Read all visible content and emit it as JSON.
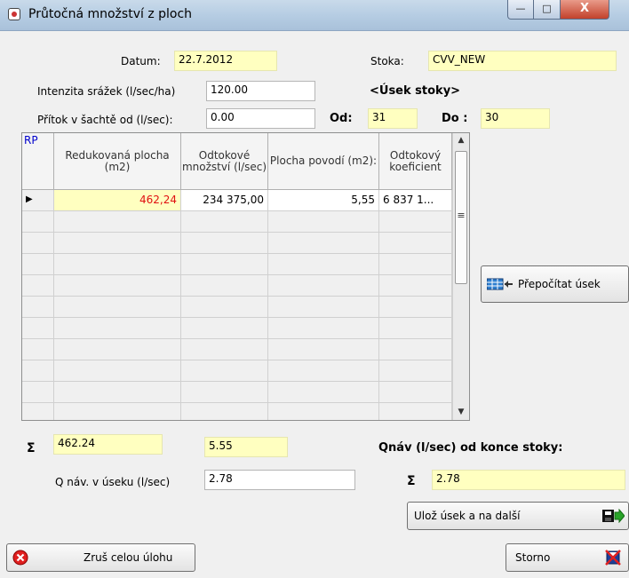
{
  "window": {
    "title": "Průtočná množství z ploch",
    "minimize": "—",
    "maximize": "□",
    "close": "X"
  },
  "form": {
    "datum_label": "Datum:",
    "datum_value": "22.7.2012",
    "stoka_label": "Stoka:",
    "stoka_value": "CVV_NEW",
    "intenzita_label": "Intenzita srážek (l/sec/ha)",
    "intenzita_value": "120.00",
    "usek_heading": "<Úsek stoky>",
    "pritok_label": "Přítok v šachtě od (l/sec):",
    "pritok_value": "0.00",
    "od_label": "Od:",
    "od_value": "31",
    "do_label": "Do :",
    "do_value": "30"
  },
  "grid": {
    "columns": [
      "RP",
      "Redukovaná plocha (m2)",
      "Odtokové množství (l/sec)",
      "Plocha povodí (m2):",
      "Odtokový koeficient"
    ],
    "rows": [
      {
        "marker": "▶",
        "redukovana": "462,24",
        "odtokove": "234 375,00",
        "plocha": "5,55",
        "koeficient": "6 837 1..."
      }
    ],
    "empty_rows": 10,
    "scroll_up": "▲",
    "scroll_down": "▼",
    "scroll_grip": "≡"
  },
  "totals": {
    "sigma": "Σ",
    "sum_redukovana": "462.24",
    "sum_plocha": "5.55",
    "qnav_heading": "Qnáv (l/sec) od konce stoky:",
    "qnav_usek_label": "Q náv. v úseku (l/sec)",
    "qnav_usek_value": "2.78",
    "qnav_sum_value": "2.78"
  },
  "buttons": {
    "prepocitat": "Přepočítat úsek",
    "uloz": "Ulož úsek a na další",
    "zrus": "Zruš celou úlohu",
    "storno": "Storno"
  },
  "colors": {
    "highlight": "#ffffc0",
    "red_value": "#e01010",
    "accent": "#0000cc"
  }
}
